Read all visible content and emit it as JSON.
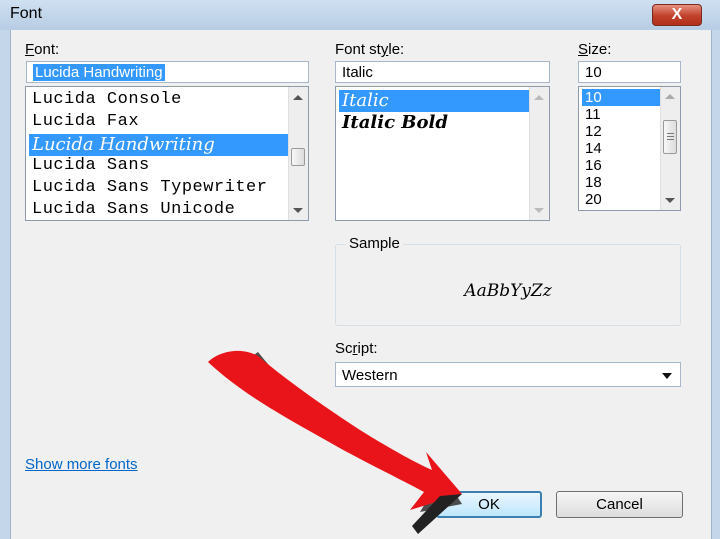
{
  "window": {
    "title": "Font",
    "close_glyph": "X"
  },
  "font": {
    "label_prefix": "",
    "label_mnemonic": "F",
    "label_rest": "ont:",
    "value": "Lucida Handwriting",
    "items": [
      "Lucida Console",
      "Lucida Fax",
      "Lucida Handwriting",
      "Lucida Sans",
      "Lucida Sans Typewriter",
      "Lucida Sans Unicode"
    ],
    "selected_index": 2
  },
  "font_style": {
    "label_prefix": "Font st",
    "label_mnemonic": "y",
    "label_rest": "le:",
    "value": "Italic",
    "items": [
      "Italic",
      "Italic Bold"
    ],
    "selected_index": 0
  },
  "size": {
    "label_prefix": "",
    "label_mnemonic": "S",
    "label_rest": "ize:",
    "value": "10",
    "items": [
      "10",
      "11",
      "12",
      "14",
      "16",
      "18",
      "20"
    ],
    "selected_index": 0
  },
  "sample": {
    "label": "Sample",
    "text": "AaBbYyZz"
  },
  "script": {
    "label_prefix": "Sc",
    "label_mnemonic": "r",
    "label_rest": "ipt:",
    "value": "Western"
  },
  "show_more_fonts": "Show more fonts",
  "buttons": {
    "ok": "OK",
    "cancel": "Cancel"
  },
  "colors": {
    "selection": "#3399ff",
    "link": "#0066cc",
    "arrow": "#e00000",
    "titlebar": "#c4d7ea"
  },
  "icons": {
    "close": "close-icon",
    "arrow_overlay": "red-arrow-annotation"
  }
}
